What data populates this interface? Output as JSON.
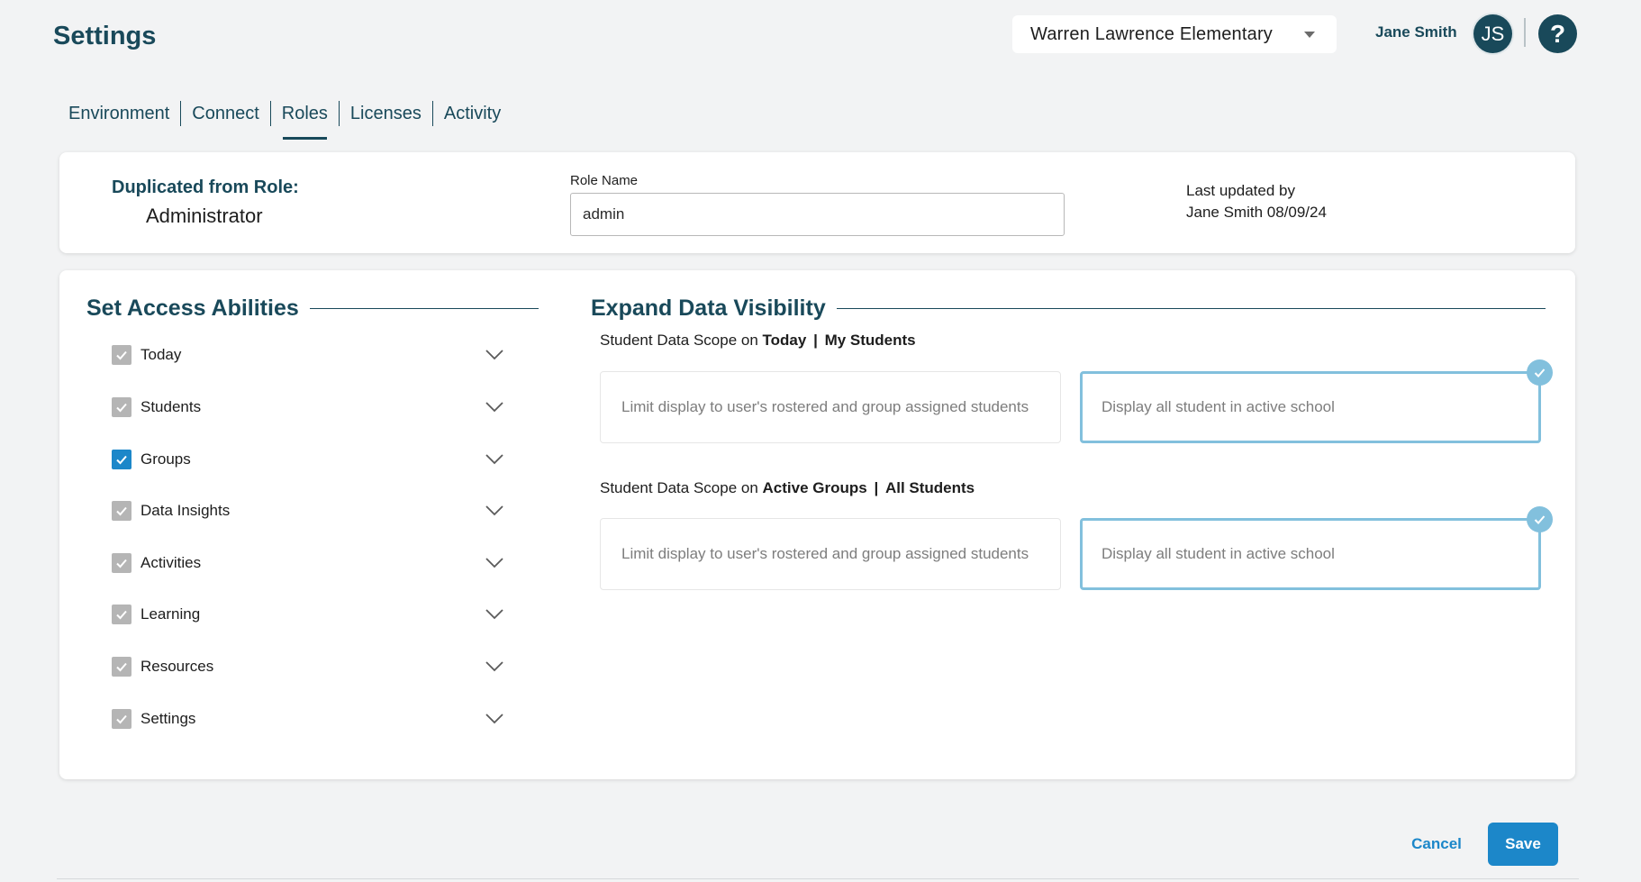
{
  "header": {
    "title": "Settings",
    "school_select": "Warren Lawrence Elementary",
    "user_name": "Jane Smith",
    "avatar_initials": "JS",
    "help_icon": "question-mark-icon"
  },
  "tabs": [
    {
      "label": "Environment",
      "active": false
    },
    {
      "label": "Connect",
      "active": false
    },
    {
      "label": "Roles",
      "active": true
    },
    {
      "label": "Licenses",
      "active": false
    },
    {
      "label": "Activity",
      "active": false
    }
  ],
  "role_info": {
    "duplicated_label": "Duplicated from Role:",
    "duplicated_value": "Administrator",
    "role_name_label": "Role Name",
    "role_name_value": "admin",
    "last_updated_label": "Last updated by",
    "last_updated_value": "Jane Smith 08/09/24"
  },
  "access": {
    "heading": "Set Access Abilities",
    "items": [
      {
        "label": "Today",
        "checked": true,
        "style": "gray"
      },
      {
        "label": "Students",
        "checked": true,
        "style": "gray"
      },
      {
        "label": "Groups",
        "checked": true,
        "style": "blue"
      },
      {
        "label": "Data Insights",
        "checked": true,
        "style": "gray"
      },
      {
        "label": "Activities",
        "checked": true,
        "style": "gray"
      },
      {
        "label": "Learning",
        "checked": true,
        "style": "gray"
      },
      {
        "label": "Resources",
        "checked": true,
        "style": "gray"
      },
      {
        "label": "Settings",
        "checked": true,
        "style": "gray"
      }
    ]
  },
  "visibility": {
    "heading": "Expand Data Visibility",
    "scopes": [
      {
        "prefix": "Student Data Scope on",
        "page": "Today",
        "separator": "|",
        "scope": "My Students",
        "option_limit": "Limit display to user's rostered and group assigned students",
        "option_all": "Display all student in active school",
        "selected": "all"
      },
      {
        "prefix": "Student Data Scope on",
        "page": "Active Groups",
        "separator": "|",
        "scope": "All Students",
        "option_limit": "Limit display to user's rostered and group assigned students",
        "option_all": "Display all student in active school",
        "selected": "all"
      }
    ]
  },
  "footer": {
    "cancel_label": "Cancel",
    "save_label": "Save"
  },
  "colors": {
    "primary_dark": "#19495a",
    "accent_blue": "#1c87c9",
    "selected_border": "#82c0dd",
    "checkbox_gray": "#b5b5b5",
    "background": "#f2f3f4"
  }
}
